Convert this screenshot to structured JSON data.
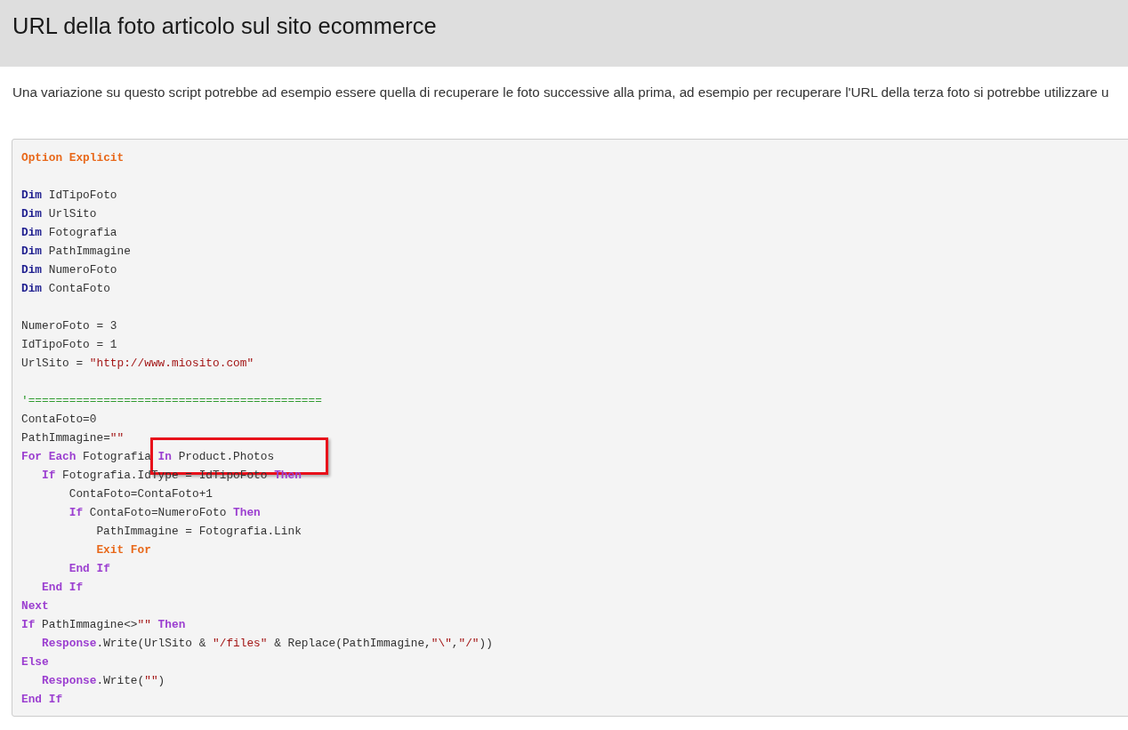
{
  "header": {
    "title": "URL della foto articolo sul sito ecommerce"
  },
  "intro": "Una variazione su questo script potrebbe ad esempio essere quella di recuperare le foto successive alla prima, ad esempio per recuperare l'URL della terza foto si potrebbe utilizzare u",
  "code": [
    {
      "kind": "code",
      "highlighted": false,
      "tokens": [
        {
          "kind": "directive",
          "text": "Option Explicit"
        }
      ]
    },
    {
      "kind": "blank"
    },
    {
      "kind": "code",
      "highlighted": false,
      "tokens": [
        {
          "kind": "declare",
          "text": "Dim"
        },
        {
          "kind": "plain",
          "text": " IdTipoFoto"
        }
      ]
    },
    {
      "kind": "code",
      "highlighted": false,
      "tokens": [
        {
          "kind": "declare",
          "text": "Dim"
        },
        {
          "kind": "plain",
          "text": " UrlSito"
        }
      ]
    },
    {
      "kind": "code",
      "highlighted": false,
      "tokens": [
        {
          "kind": "declare",
          "text": "Dim"
        },
        {
          "kind": "plain",
          "text": " Fotografia"
        }
      ]
    },
    {
      "kind": "code",
      "highlighted": false,
      "tokens": [
        {
          "kind": "declare",
          "text": "Dim"
        },
        {
          "kind": "plain",
          "text": " PathImmagine"
        }
      ]
    },
    {
      "kind": "code",
      "highlighted": false,
      "tokens": [
        {
          "kind": "declare",
          "text": "Dim"
        },
        {
          "kind": "plain",
          "text": " NumeroFoto"
        }
      ]
    },
    {
      "kind": "code",
      "highlighted": false,
      "tokens": [
        {
          "kind": "declare",
          "text": "Dim"
        },
        {
          "kind": "plain",
          "text": " ContaFoto"
        }
      ]
    },
    {
      "kind": "blank"
    },
    {
      "kind": "code",
      "highlighted": false,
      "tokens": [
        {
          "kind": "plain",
          "text": "NumeroFoto = 3"
        }
      ]
    },
    {
      "kind": "code",
      "highlighted": false,
      "tokens": [
        {
          "kind": "plain",
          "text": "IdTipoFoto = 1"
        }
      ]
    },
    {
      "kind": "code",
      "highlighted": false,
      "tokens": [
        {
          "kind": "plain",
          "text": "UrlSito = "
        },
        {
          "kind": "string",
          "text": "\"http://www.miosito.com\""
        }
      ]
    },
    {
      "kind": "blank"
    },
    {
      "kind": "code",
      "highlighted": false,
      "tokens": [
        {
          "kind": "comment",
          "text": "'==========================================="
        }
      ]
    },
    {
      "kind": "code",
      "highlighted": false,
      "tokens": [
        {
          "kind": "plain",
          "text": "ContaFoto=0"
        }
      ]
    },
    {
      "kind": "code",
      "highlighted": false,
      "tokens": [
        {
          "kind": "plain",
          "text": "PathImmagine="
        },
        {
          "kind": "string",
          "text": "\"\""
        }
      ]
    },
    {
      "kind": "code",
      "highlighted": true,
      "tokens": [
        {
          "kind": "keyword",
          "text": "For Each"
        },
        {
          "kind": "plain",
          "text": " Fotografia "
        },
        {
          "kind": "keyword",
          "text": "In"
        },
        {
          "kind": "plain",
          "text": " Product.Photos"
        }
      ],
      "children": [
        {
          "kind": "code",
          "highlighted": false,
          "tokens": [
            {
              "kind": "keyword",
              "text": "If"
            },
            {
              "kind": "plain",
              "text": " Fotografia.IdType = IdTipoFoto "
            },
            {
              "kind": "keyword",
              "text": "Then"
            }
          ],
          "children": [
            {
              "kind": "code",
              "highlighted": false,
              "tokens": [
                {
                  "kind": "plain",
                  "text": "ContaFoto=ContaFoto+1"
                }
              ]
            },
            {
              "kind": "code",
              "highlighted": false,
              "tokens": [
                {
                  "kind": "keyword",
                  "text": "If"
                },
                {
                  "kind": "plain",
                  "text": " ContaFoto=NumeroFoto "
                },
                {
                  "kind": "keyword",
                  "text": "Then"
                }
              ],
              "children": [
                {
                  "kind": "code",
                  "highlighted": false,
                  "tokens": [
                    {
                      "kind": "plain",
                      "text": "PathImmagine = Fotografia.Link"
                    }
                  ]
                },
                {
                  "kind": "code",
                  "highlighted": false,
                  "tokens": [
                    {
                      "kind": "directive",
                      "text": "Exit For"
                    }
                  ]
                }
              ]
            },
            {
              "kind": "code",
              "highlighted": false,
              "tokens": [
                {
                  "kind": "keyword",
                  "text": "End If"
                }
              ]
            }
          ]
        },
        {
          "kind": "code",
          "highlighted": false,
          "tokens": [
            {
              "kind": "keyword",
              "text": "End If"
            }
          ]
        }
      ]
    },
    {
      "kind": "code",
      "highlighted": false,
      "tokens": [
        {
          "kind": "keyword",
          "text": "Next"
        }
      ]
    },
    {
      "kind": "code",
      "highlighted": false,
      "tokens": [
        {
          "kind": "keyword",
          "text": "If"
        },
        {
          "kind": "plain",
          "text": " PathImmagine<>"
        },
        {
          "kind": "string",
          "text": "\"\""
        },
        {
          "kind": "keyword",
          "text": " Then"
        }
      ],
      "children": [
        {
          "kind": "code",
          "highlighted": false,
          "tokens": [
            {
              "kind": "keyword",
              "text": "Response"
            },
            {
              "kind": "plain",
              "text": ".Write(UrlSito & "
            },
            {
              "kind": "string",
              "text": "\"/files\""
            },
            {
              "kind": "plain",
              "text": " & Replace(PathImmagine,"
            },
            {
              "kind": "string",
              "text": "\"\\\""
            },
            {
              "kind": "plain",
              "text": ","
            },
            {
              "kind": "string",
              "text": "\"/\""
            },
            {
              "kind": "plain",
              "text": "))"
            }
          ]
        }
      ]
    },
    {
      "kind": "code",
      "highlighted": false,
      "tokens": [
        {
          "kind": "keyword",
          "text": "Else"
        }
      ],
      "children": [
        {
          "kind": "code",
          "highlighted": false,
          "tokens": [
            {
              "kind": "keyword",
              "text": "Response"
            },
            {
              "kind": "plain",
              "text": ".Write("
            },
            {
              "kind": "string",
              "text": "\"\""
            },
            {
              "kind": "plain",
              "text": ")"
            }
          ]
        }
      ]
    },
    {
      "kind": "code",
      "highlighted": false,
      "tokens": [
        {
          "kind": "keyword",
          "text": "End If"
        }
      ]
    }
  ]
}
